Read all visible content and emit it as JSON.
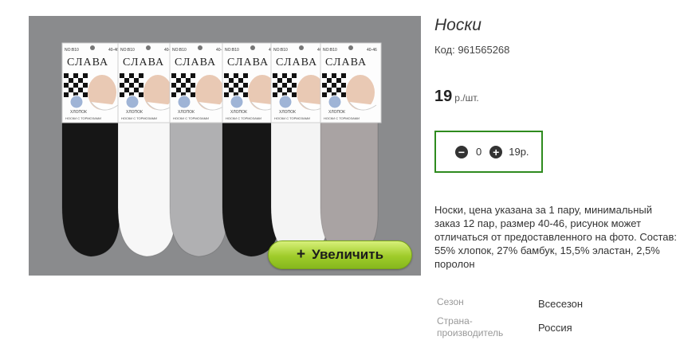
{
  "product": {
    "title": "Носки",
    "code": "Код: 961565268",
    "price_value": "19",
    "price_unit": "р./шт.",
    "zoom_label": "Увеличить",
    "zoom_plus": "+",
    "description": "Носки, цена указана за 1 пару, минимальный заказ 12 пар, размер 40-46, рисунок может отличаться от предоставленного на фото. Состав: 55% хлопок, 27% бамбук, 15,5% эластан, 2,5% поролон"
  },
  "cart": {
    "minus_icon": "minus-icon",
    "plus_icon": "plus-icon",
    "quantity": "0",
    "total": "19р."
  },
  "packaging": {
    "brand": "СЛАВА",
    "model": "NO:B10",
    "size": "40-46",
    "material": "ХЛОПОК",
    "subtitle": "НОСКИ С ТОРМОЗАМИ"
  },
  "properties": [
    {
      "key": "Сезон",
      "value": "Всесезон"
    },
    {
      "key": "Страна-\nпроизводитель",
      "value": "Россия"
    }
  ],
  "colors": {
    "accent_green": "#2e8b1e",
    "button_green": "#9fcc2a",
    "photo_bg": "#8a8b8d"
  }
}
